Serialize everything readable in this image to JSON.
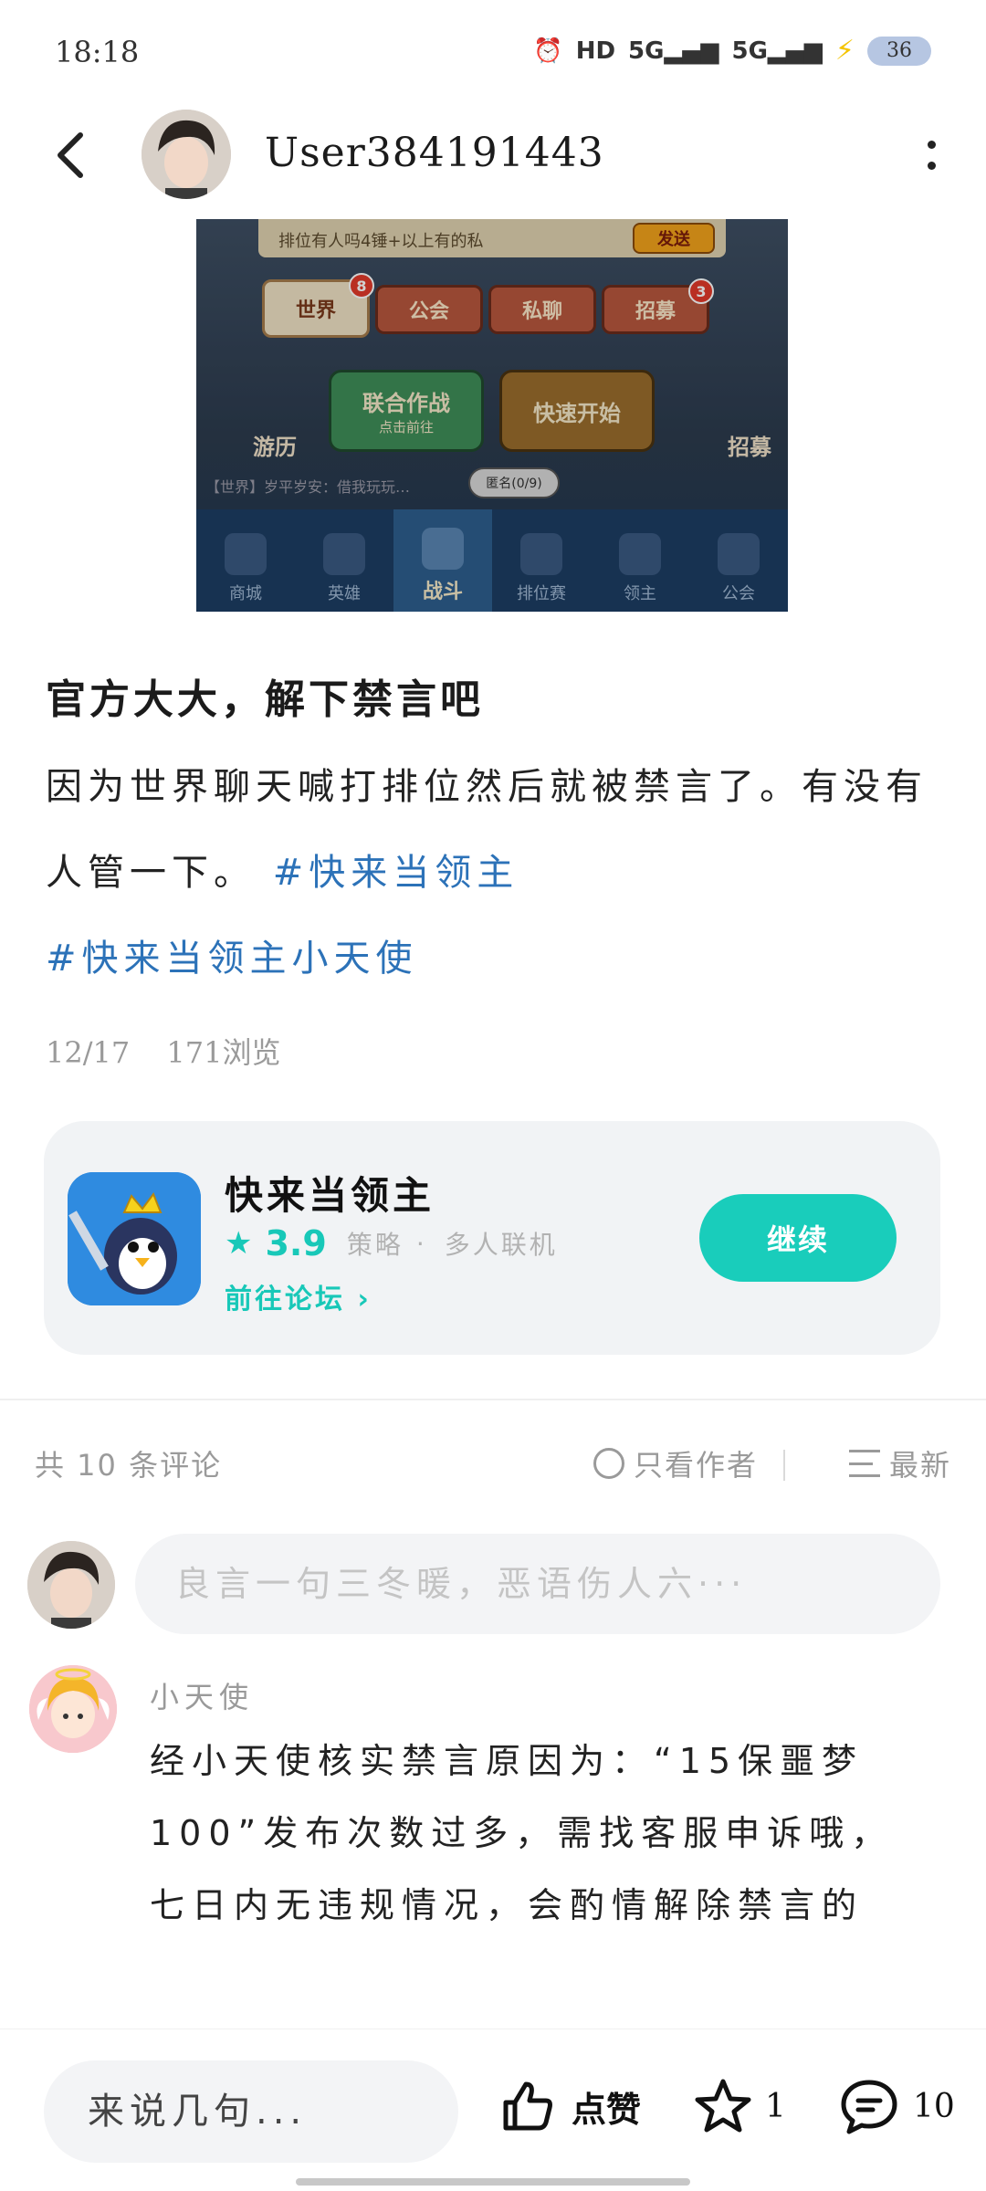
{
  "status_bar": {
    "time": "18:18",
    "hd": "HD",
    "net1": "5G",
    "net2": "5G",
    "battery": "36"
  },
  "header": {
    "username": "User384191443",
    "back_icon": "chevron-left-icon",
    "more_icon": "more-vertical-icon"
  },
  "screenshot": {
    "chat_placeholder": "排位有人吗4锤+以上有的私",
    "send": "发送",
    "tabs": [
      {
        "label": "世界",
        "badge": "8"
      },
      {
        "label": "公会",
        "badge": ""
      },
      {
        "label": "私聊",
        "badge": ""
      },
      {
        "label": "招募",
        "badge": "3"
      }
    ],
    "btn_union": "联合作战",
    "btn_union_sub": "点击前往",
    "btn_quick": "快速开始",
    "side_left": "游历",
    "side_right": "招募",
    "broadcast": "【世界】岁平岁安：借我玩玩…",
    "pill": "匿名(0/9)",
    "nav": [
      "商城",
      "英雄",
      "战斗",
      "排位赛",
      "领主",
      "公会"
    ]
  },
  "post": {
    "title": "官方大大，解下禁言吧",
    "body": "因为世界聊天喊打排位然后就被禁言了。有没有人管一下。",
    "hashtag1": "#快来当领主",
    "hashtag2": "#快来当领主小天使",
    "date": "12/17",
    "views": "171浏览"
  },
  "game_card": {
    "name": "快来当领主",
    "rating": "3.9",
    "tag1": "策略",
    "dot": "·",
    "tag2": "多人联机",
    "forum_link": "前往论坛 ›",
    "continue": "继续"
  },
  "comments": {
    "count_label": "共 10 条评论",
    "only_author": "只看作者",
    "sort": "最新",
    "input_placeholder": "良言一句三冬暖，恶语伤人六···"
  },
  "comment_list": [
    {
      "author": "小天使",
      "text": "经小天使核实禁言原因为：“15保噩梦100”发布次数过多，需找客服申诉哦，七日内无违规情况，会酌情解除禁言的"
    }
  ],
  "bottom_bar": {
    "say_placeholder": "来说几句...",
    "like": "点赞",
    "favorites": "1",
    "comments": "10"
  },
  "colors": {
    "accent": "#19cdbb",
    "hashtag": "#2c72b8",
    "muted": "#9a9a9a"
  }
}
